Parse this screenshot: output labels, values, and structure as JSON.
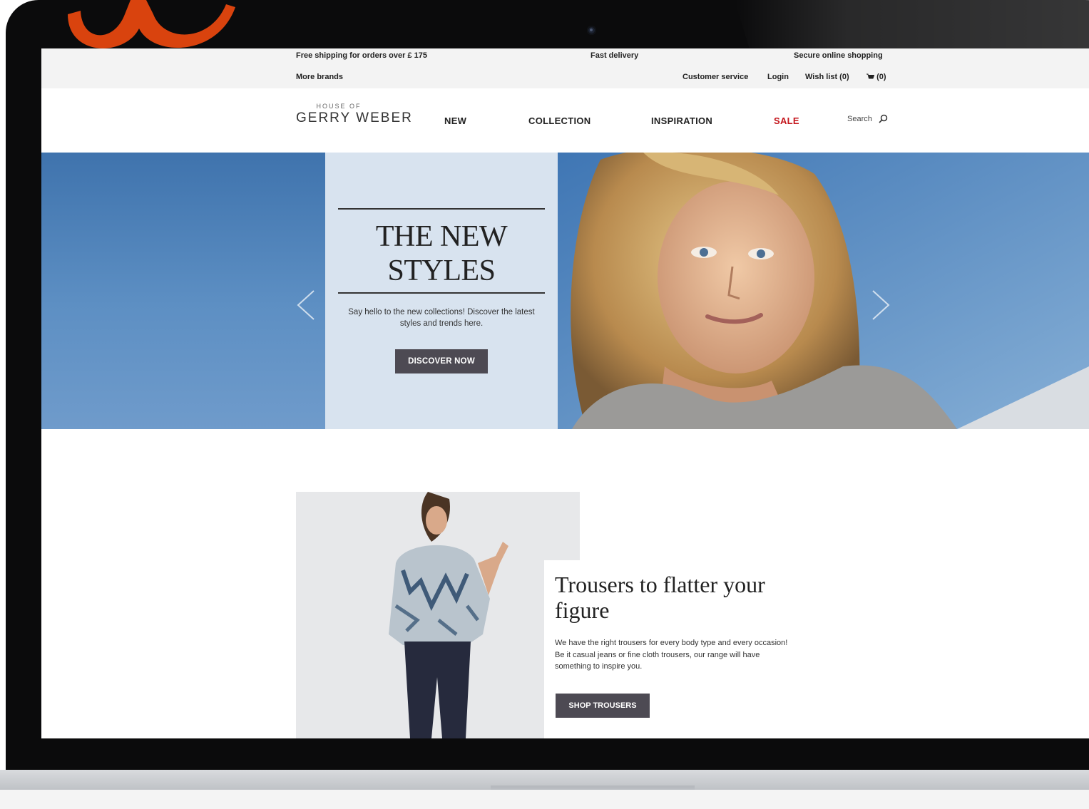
{
  "topbar": {
    "free_shipping": "Free shipping for orders over £ 175",
    "fast_delivery": "Fast delivery",
    "secure_shopping": "Secure online shopping",
    "more_brands": "More brands",
    "customer_service": "Customer service",
    "login": "Login",
    "wish_list": "Wish list (0)",
    "cart_count": "(0)"
  },
  "header": {
    "logo_small": "HOUSE OF",
    "logo_main": "GERRY WEBER",
    "nav": [
      "NEW",
      "COLLECTION",
      "INSPIRATION",
      "SALE"
    ],
    "search_label": "Search"
  },
  "hero": {
    "title_line1": "THE NEW",
    "title_line2": "STYLES",
    "text": "Say hello to the new collections! Discover the latest styles and trends here.",
    "button": "DISCOVER NOW"
  },
  "promo": {
    "title": "Trousers to flatter your figure",
    "text": "We have the right trousers for every body type and every occasion! Be it casual jeans or fine cloth trousers, our range will have something to inspire you.",
    "button": "SHOP TROUSERS"
  },
  "colors": {
    "accent_sale": "#c4161c",
    "button_bg": "#4d4a53",
    "hero_blue": "#4f7fb5",
    "brand_orange": "#d9430e"
  },
  "icons": [
    "search-icon",
    "cart-icon",
    "chevron-left-icon",
    "chevron-right-icon"
  ]
}
